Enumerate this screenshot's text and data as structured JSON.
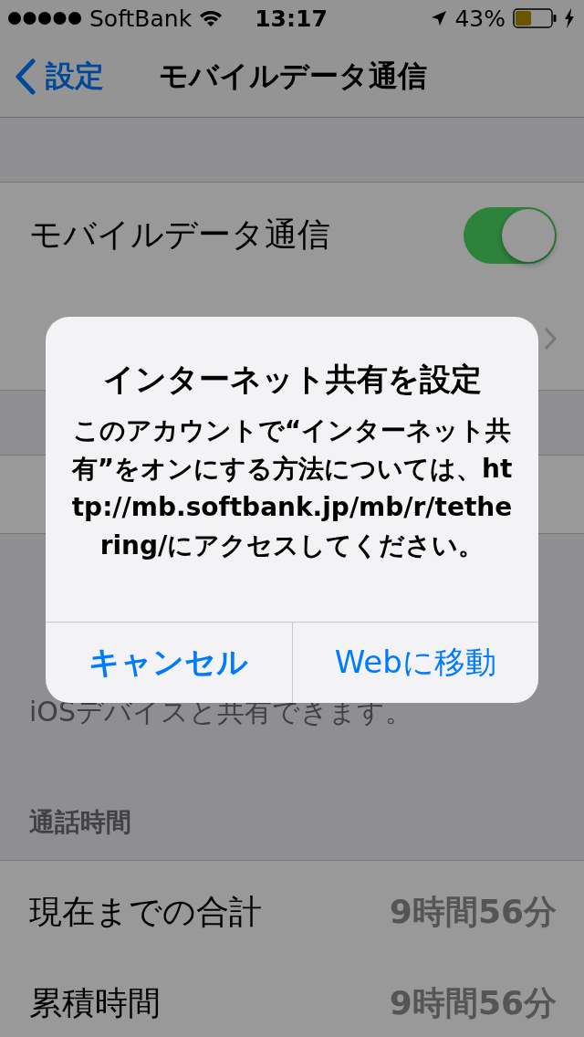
{
  "status_bar": {
    "carrier": "SoftBank",
    "time": "13:17",
    "battery": "43%"
  },
  "nav": {
    "back": "設定",
    "title": "モバイルデータ通信"
  },
  "groups": [
    {
      "rows": [
        {
          "kind": "toggle",
          "label": "モバイルデータ通信",
          "on": true
        },
        {
          "kind": "disclosure"
        }
      ]
    },
    {
      "rows": [
        {
          "kind": "link"
        }
      ],
      "footer": [
        "iOSデバイスと共有できます。"
      ]
    },
    {
      "header": "通話時間",
      "rows": [
        {
          "kind": "value",
          "label": "現在までの合計",
          "value": "9時間56分"
        },
        {
          "kind": "value",
          "label": "累積時間",
          "value": "9時間56分"
        }
      ]
    }
  ],
  "alert": {
    "title": "インターネット共有を設定",
    "message": "このアカウントで“インターネット共有”をオンにする方法については、http://mb.softbank.jp/mb/r/tethering/にアクセスしてください。",
    "buttons": [
      {
        "kind": "cancel",
        "label": "キャンセル"
      },
      {
        "kind": "default",
        "label": "Webに移動"
      }
    ]
  }
}
